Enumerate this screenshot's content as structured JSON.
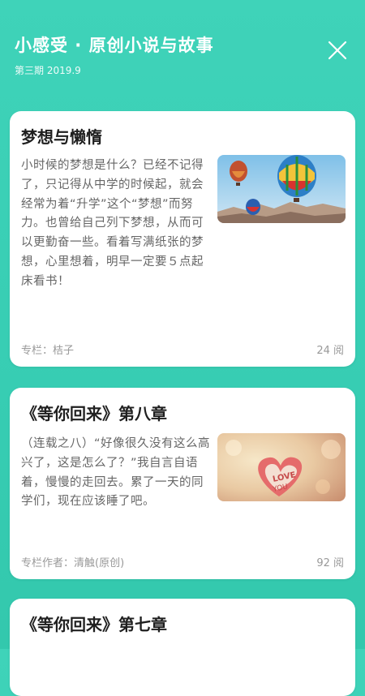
{
  "header": {
    "title": "小感受 · 原创小说与故事",
    "issue": "第三期 2019.9"
  },
  "cards": [
    {
      "title": "梦想与懒惰",
      "excerpt": "小时候的梦想是什么？已经不记得了，只记得从中学的时候起，就会经常为着“升学”这个“梦想”而努力。也曾给自己列下梦想，从而可以更勤奋一些。看着写满纸张的梦想，心里想着，明早一定要５点起床看书！",
      "author": "专栏：桔子",
      "reads": "24 阅",
      "image": "hot-air-balloons"
    },
    {
      "title": "《等你回来》第八章",
      "excerpt": "（连载之八）“好像很久没有这么高兴了，这是怎么了？”我自言自语着，慢慢的走回去。累了一天的同学们，现在应该睡了吧。",
      "author": "专栏作者：清触(原创)",
      "reads": "92 阅",
      "image": "love-heart"
    },
    {
      "title": "《等你回来》第七章"
    }
  ]
}
